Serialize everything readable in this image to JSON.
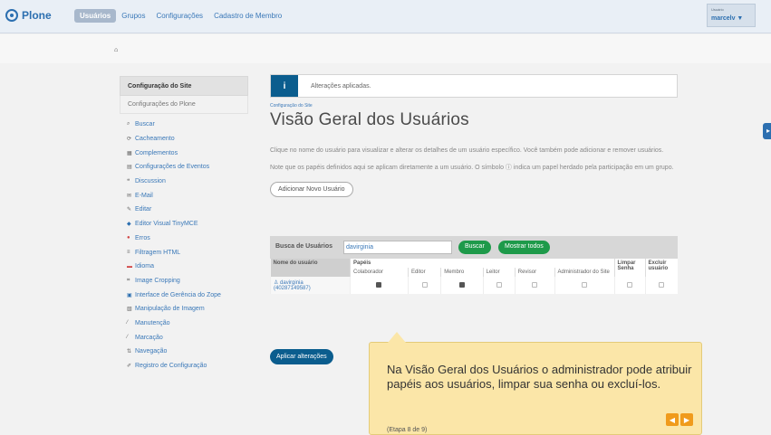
{
  "topbar": {
    "logo_text": "Plone",
    "nav": [
      "Usuários",
      "Grupos",
      "Configurações",
      "Cadastro de Membro"
    ],
    "user_small": "Usuário",
    "user_name": "marcelv ▼"
  },
  "breadcrumb": {
    "home_icon": "home-icon"
  },
  "sidebar": {
    "header": "Configuração do Site",
    "subheader": "Configurações do Plone",
    "items": [
      {
        "label": "Buscar",
        "icon": "search-icon"
      },
      {
        "label": "Cacheamento",
        "icon": "cache-icon"
      },
      {
        "label": "Complementos",
        "icon": "addons-icon"
      },
      {
        "label": "Configurações de Eventos",
        "icon": "events-icon"
      },
      {
        "label": "Discussion",
        "icon": "discussion-icon"
      },
      {
        "label": "E-Mail",
        "icon": "mail-icon"
      },
      {
        "label": "Editar",
        "icon": "edit-icon"
      },
      {
        "label": "Editor Visual TinyMCE",
        "icon": "tinymce-icon"
      },
      {
        "label": "Erros",
        "icon": "errors-icon"
      },
      {
        "label": "Filtragem HTML",
        "icon": "filter-icon"
      },
      {
        "label": "Idioma",
        "icon": "language-icon"
      },
      {
        "label": "Image Cropping",
        "icon": "crop-icon"
      },
      {
        "label": "Interface de Gerência do Zope",
        "icon": "zmi-icon"
      },
      {
        "label": "Manipulação de Imagem",
        "icon": "image-icon"
      },
      {
        "label": "Manutenção",
        "icon": "maintenance-icon"
      },
      {
        "label": "Marcação",
        "icon": "markup-icon"
      },
      {
        "label": "Navegação",
        "icon": "navigation-icon"
      },
      {
        "label": "Registro de Configuração",
        "icon": "registry-icon"
      }
    ]
  },
  "main": {
    "alert_icon": "i",
    "alert": "Alterações aplicadas.",
    "small_crumb": "Configuração do Site",
    "title": "Visão Geral dos Usuários",
    "desc1": "Clique no nome do usuário para visualizar e alterar os detalhes de um usuário específico. Você também pode adicionar e remover usuários.",
    "desc2": "Note que os papéis definidos aqui se aplicam diretamente a um usuário. O símbolo ⓘ indica um papel herdado pela participação em um grupo.",
    "add_button": "Adicionar Novo Usuário",
    "search_label": "Busca de Usuários",
    "search_value": "davirginia",
    "search_button": "Buscar",
    "show_all_button": "Mostrar todos",
    "table": {
      "col_name": "Nome do usuário",
      "col_roles": "Papéis",
      "col_reset": "Limpar Senha",
      "col_delete": "Excluir usuário",
      "roles": [
        "Colaborador",
        "Editor",
        "Membro",
        "Leitor",
        "Revisor",
        "Administrador do Site"
      ],
      "row": {
        "name": "davirginia",
        "id": "(40287149587)",
        "checks": [
          true,
          false,
          true,
          false,
          false,
          false
        ],
        "reset": false,
        "delete": false
      }
    },
    "apply_button": "Aplicar alterações"
  },
  "tooltip": {
    "text": "Na Visão Geral dos Usuários o administrador pode atribuir papéis aos usuários, limpar sua senha ou excluí-los.",
    "step": "(Etapa 8 de 9)",
    "prev": "◀",
    "next": "▶"
  }
}
